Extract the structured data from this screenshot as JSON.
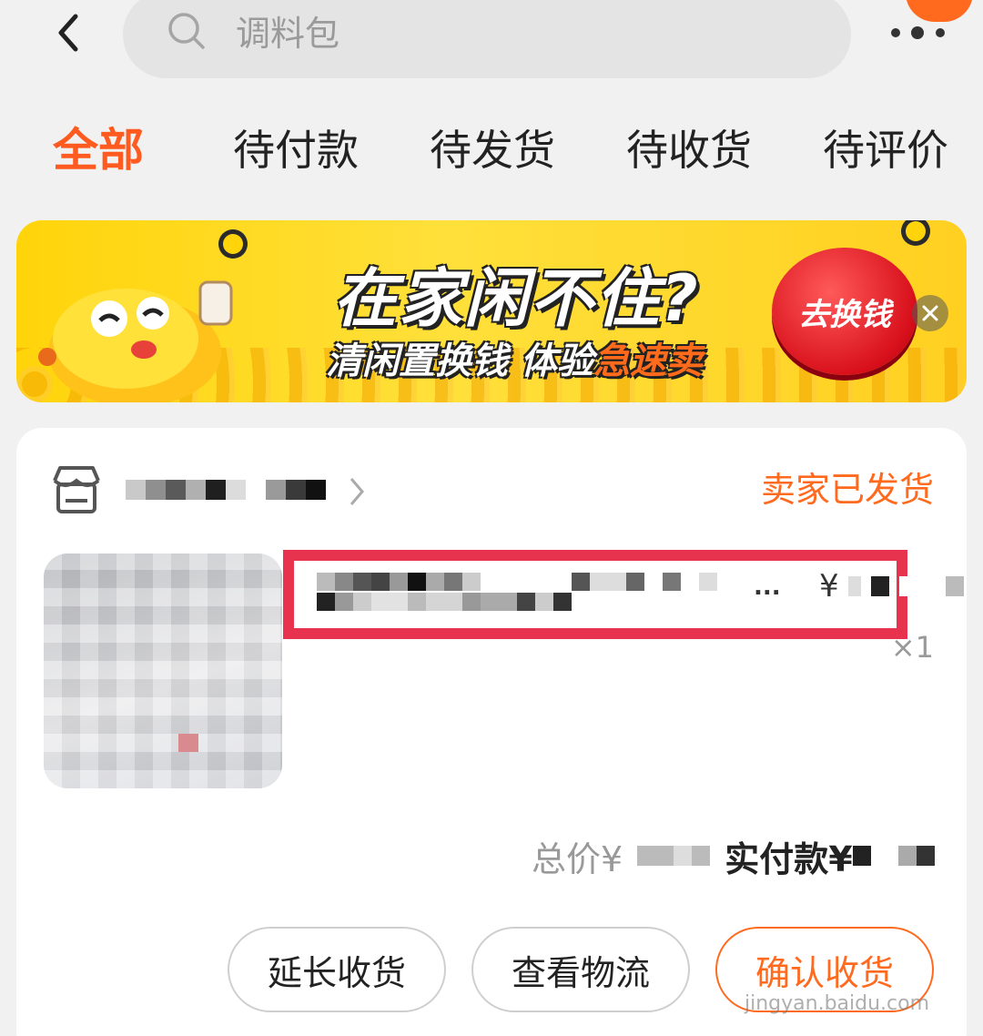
{
  "search": {
    "placeholder": "调料包"
  },
  "tabs": [
    {
      "label": "全部",
      "active": true
    },
    {
      "label": "待付款"
    },
    {
      "label": "待发货"
    },
    {
      "label": "待收货"
    },
    {
      "label": "待评价"
    }
  ],
  "banner": {
    "headline": "在家闲不住?",
    "sub_main": "清闲置换钱 体验",
    "sub_highlight": "急速卖",
    "cta": "去换钱"
  },
  "order": {
    "status": "卖家已发货",
    "title_suffix": "...",
    "price_symbol": "¥",
    "quantity": "×1",
    "total_label": "总价¥",
    "paid_label": "实付款¥",
    "buttons": {
      "extend": "延长收货",
      "logistics": "查看物流",
      "confirm": "确认收货"
    }
  },
  "colors": {
    "accent": "#ff5a1f",
    "highlight_box": "#e8334f"
  },
  "watermark": "jingyan.baidu.com"
}
